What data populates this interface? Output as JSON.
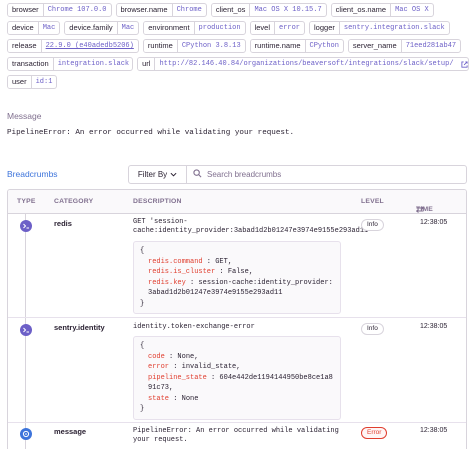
{
  "tags": [
    [
      {
        "key": "browser",
        "value": "Chrome 107.0.0"
      },
      {
        "key": "browser.name",
        "value": "Chrome"
      },
      {
        "key": "client_os",
        "value": "Mac OS X 10.15.7"
      },
      {
        "key": "client_os.name",
        "value": "Mac OS X"
      }
    ],
    [
      {
        "key": "device",
        "value": "Mac"
      },
      {
        "key": "device.family",
        "value": "Mac"
      },
      {
        "key": "environment",
        "value": "production"
      },
      {
        "key": "level",
        "value": "error"
      },
      {
        "key": "logger",
        "value": "sentry.integration.slack"
      }
    ],
    [
      {
        "key": "release",
        "value": "22.9.0 (e40adedb5206)",
        "underline": true
      },
      {
        "key": "runtime",
        "value": "CPython 3.8.13"
      },
      {
        "key": "runtime.name",
        "value": "CPython"
      },
      {
        "key": "server_name",
        "value": "71eed281ab47"
      }
    ],
    [
      {
        "key": "transaction",
        "value": "integration.slack"
      },
      {
        "key": "url",
        "value": "http://82.146.40.84/organizations/beaversoft/integrations/slack/setup/"
      }
    ],
    [
      {
        "key": "user",
        "value": "id:1"
      }
    ]
  ],
  "message": {
    "title": "Message",
    "text": "PipelineError: An error occurred while validating your request."
  },
  "breadcrumbs": {
    "title": "Breadcrumbs",
    "filter_label": "Filter By",
    "search_placeholder": "Search breadcrumbs",
    "columns": {
      "type": "TYPE",
      "category": "CATEGORY",
      "description": "DESCRIPTION",
      "level": "LEVEL",
      "time": "TIME"
    },
    "rows": [
      {
        "type_icon": "terminal-icon",
        "category": "redis",
        "description": "GET 'session-cache:identity_provider:3abad1d2b01247e3974e9155e293ad11'",
        "data_lines": [
          {
            "text": "{"
          },
          {
            "key": "redis.command",
            "value": "GET,"
          },
          {
            "key": "redis.is_cluster",
            "value": "False,"
          },
          {
            "key": "redis.key",
            "value": "session-cache:identity_provider:3abad1d2b01247e3974e9155e293ad11"
          },
          {
            "text": "}"
          }
        ],
        "level": "Info",
        "time": "12:38:05"
      },
      {
        "type_icon": "terminal-icon",
        "category": "sentry.identity",
        "description": "identity.token-exchange-error",
        "data_lines": [
          {
            "text": "{"
          },
          {
            "key": "code",
            "value": "None,"
          },
          {
            "key": "error",
            "value": "invalid_state,"
          },
          {
            "key": "pipeline_state",
            "value": "604e442de1194144950be8ce1a891c73,"
          },
          {
            "key": "state",
            "value": "None"
          },
          {
            "text": "}"
          }
        ],
        "level": "Info",
        "time": "12:38:05"
      },
      {
        "type_icon": "error-icon",
        "category": "message",
        "description": "PipelineError: An error occurred while validating your request.",
        "level": "Error",
        "time": "12:38:05"
      }
    ]
  },
  "colors": {
    "accent": "#6c5fc7",
    "link": "#3d74db",
    "error": "#e03e2f",
    "border": "#d8d4dc"
  }
}
